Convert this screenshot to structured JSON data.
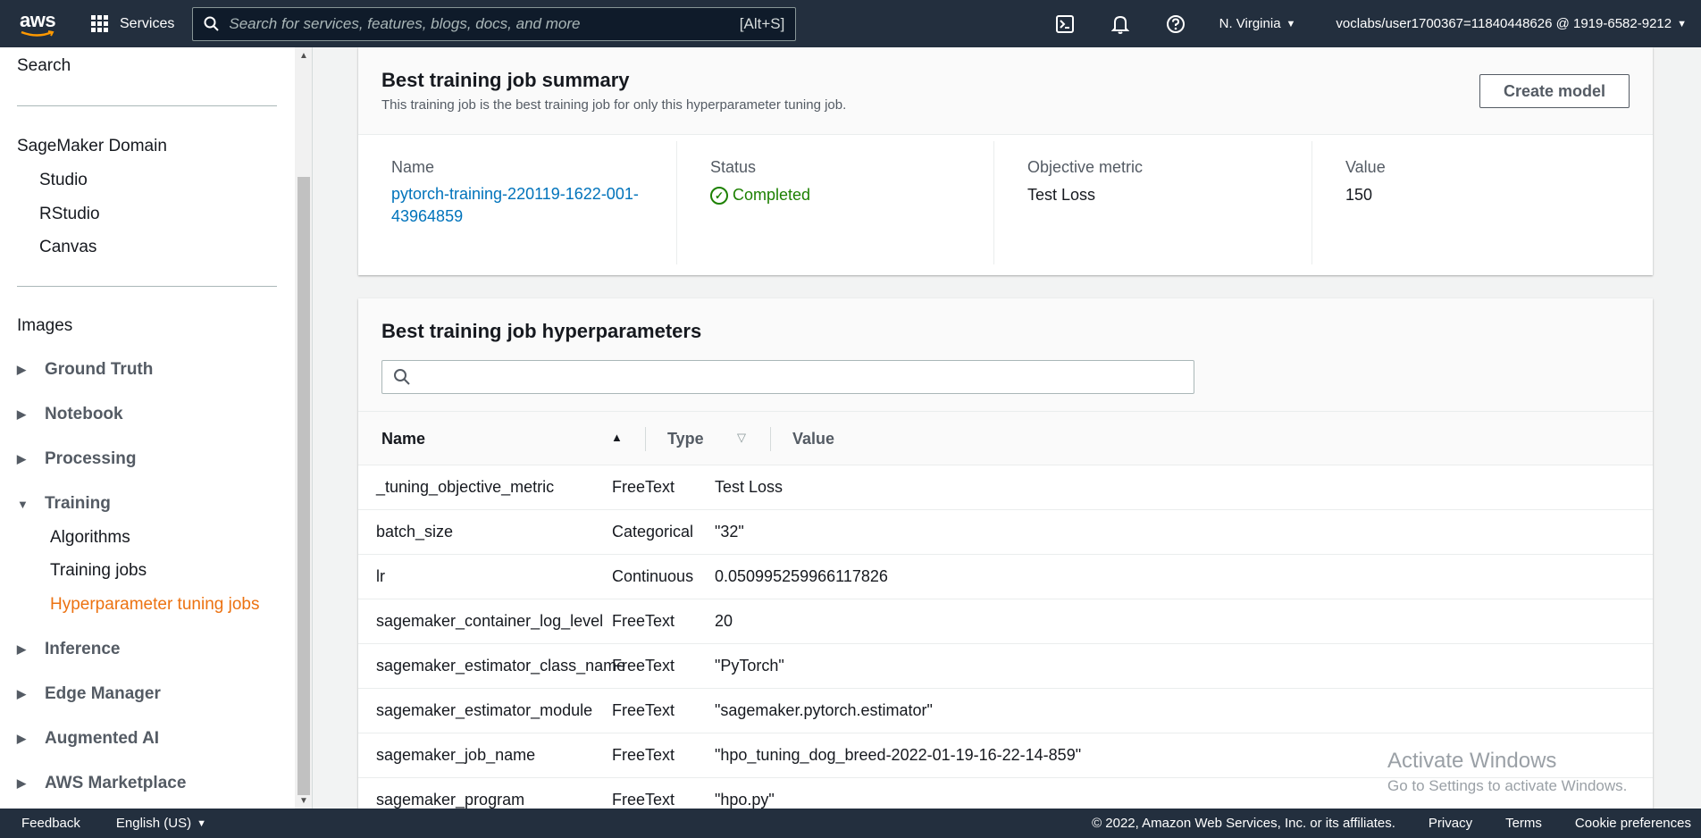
{
  "topnav": {
    "logo": "aws",
    "services_label": "Services",
    "search_placeholder": "Search for services, features, blogs, docs, and more",
    "search_shortcut": "[Alt+S]",
    "region": "N. Virginia",
    "account": "voclabs/user1700367=11840448626 @ 1919-6582-9212"
  },
  "sidebar": {
    "search_label": "Search",
    "domain_heading": "SageMaker Domain",
    "domain_items": [
      "Studio",
      "RStudio",
      "Canvas"
    ],
    "images_label": "Images",
    "sections": [
      {
        "label": "Ground Truth"
      },
      {
        "label": "Notebook"
      },
      {
        "label": "Processing"
      },
      {
        "label": "Training"
      },
      {
        "label": "Inference"
      },
      {
        "label": "Edge Manager"
      },
      {
        "label": "Augmented AI"
      },
      {
        "label": "AWS Marketplace"
      }
    ],
    "training_items": [
      "Algorithms",
      "Training jobs",
      "Hyperparameter tuning jobs"
    ]
  },
  "summary": {
    "title": "Best training job summary",
    "description": "This training job is the best training job for only this hyperparameter tuning job.",
    "create_button": "Create model",
    "name_label": "Name",
    "name_value": "pytorch-training-220119-1622-001-43964859",
    "status_label": "Status",
    "status_value": "Completed",
    "metric_label": "Objective metric",
    "metric_value": "Test Loss",
    "value_label": "Value",
    "value_value": "150"
  },
  "hyperparameters": {
    "title": "Best training job hyperparameters",
    "search_placeholder": "",
    "columns": [
      "Name",
      "Type",
      "Value"
    ],
    "rows": [
      {
        "name": "_tuning_objective_metric",
        "type": "FreeText",
        "value": "Test Loss"
      },
      {
        "name": "batch_size",
        "type": "Categorical",
        "value": "\"32\""
      },
      {
        "name": "lr",
        "type": "Continuous",
        "value": "0.050995259966117826"
      },
      {
        "name": "sagemaker_container_log_level",
        "type": "FreeText",
        "value": "20"
      },
      {
        "name": "sagemaker_estimator_class_name",
        "type": "FreeText",
        "value": "\"PyTorch\""
      },
      {
        "name": "sagemaker_estimator_module",
        "type": "FreeText",
        "value": "\"sagemaker.pytorch.estimator\""
      },
      {
        "name": "sagemaker_job_name",
        "type": "FreeText",
        "value": "\"hpo_tuning_dog_breed-2022-01-19-16-22-14-859\""
      },
      {
        "name": "sagemaker_program",
        "type": "FreeText",
        "value": "\"hpo.py\""
      }
    ]
  },
  "watermark": {
    "line1": "Activate Windows",
    "line2": "Go to Settings to activate Windows."
  },
  "footer": {
    "feedback": "Feedback",
    "language": "English (US)",
    "copyright": "© 2022, Amazon Web Services, Inc. or its affiliates.",
    "privacy": "Privacy",
    "terms": "Terms",
    "cookies": "Cookie preferences"
  },
  "colors": {
    "nav_bg": "#232f3e",
    "link": "#0073bb",
    "active": "#ec7211",
    "success": "#1d8102"
  }
}
